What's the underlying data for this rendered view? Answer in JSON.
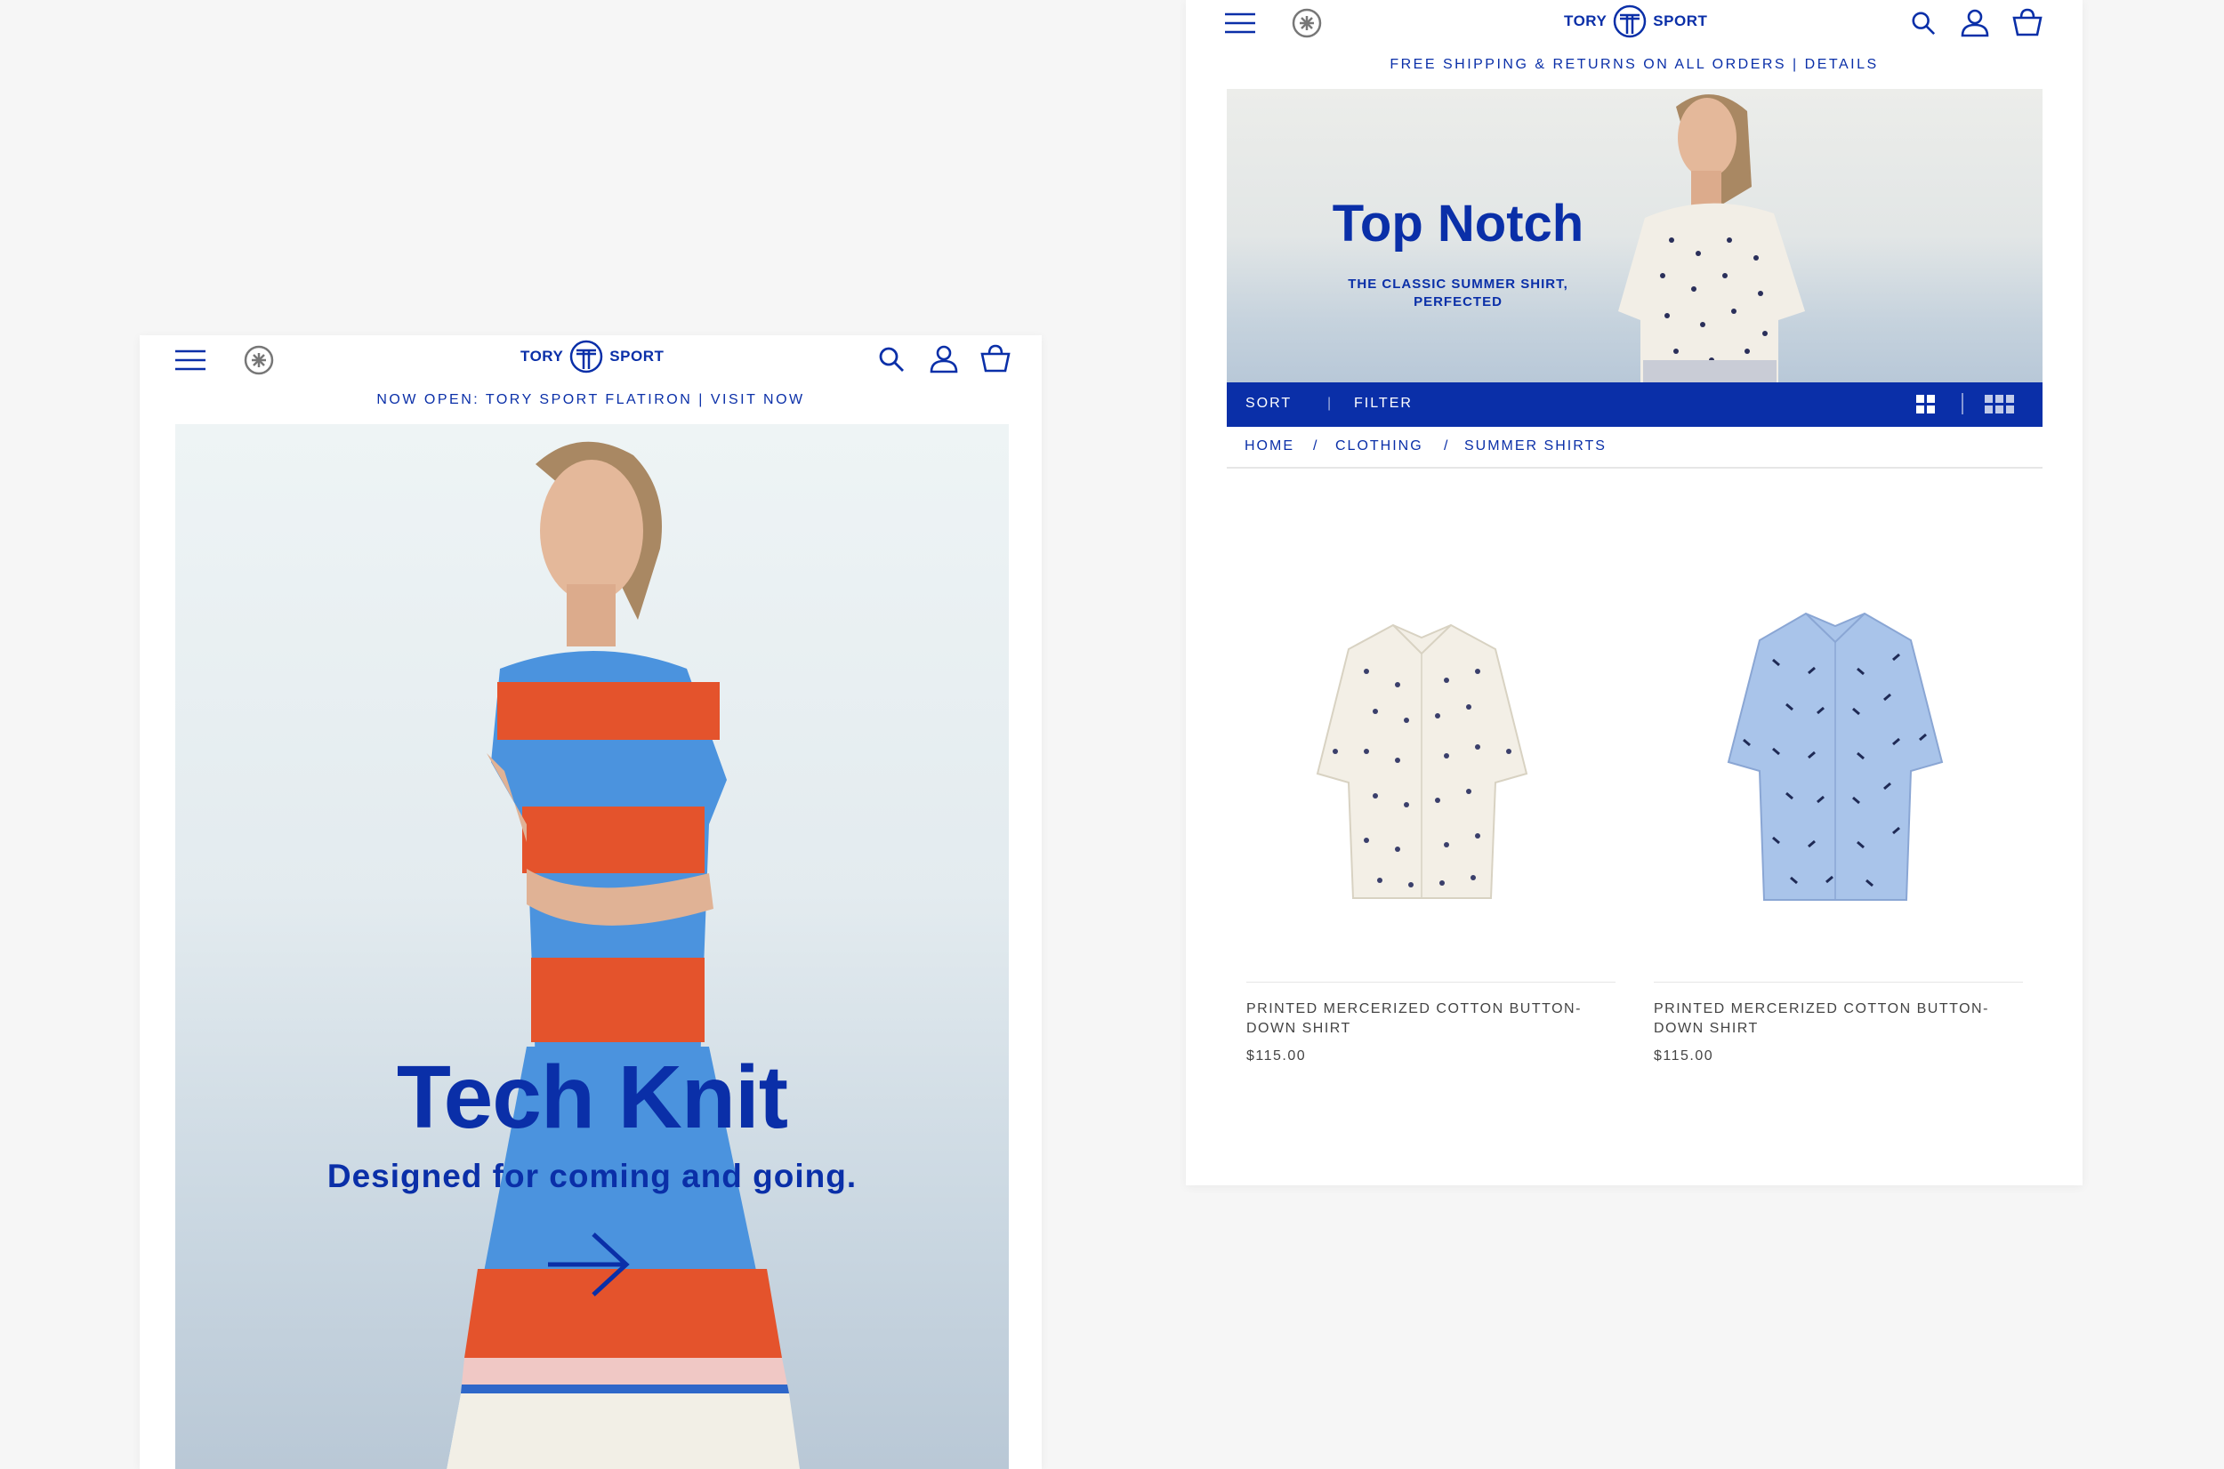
{
  "left_screen": {
    "logo": {
      "left": "TORY",
      "right": "SPORT"
    },
    "promo": "NOW OPEN: TORY SPORT FLATIRON | VISIT NOW",
    "hero": {
      "title": "Tech Knit",
      "subtitle": "Designed for coming and going."
    },
    "icons": [
      "menu-icon",
      "tory-medallion-icon",
      "search-icon",
      "account-icon",
      "shopping-bag-icon",
      "arrow-right-icon"
    ]
  },
  "right_screen": {
    "logo": {
      "left": "TORY",
      "right": "SPORT"
    },
    "promo": "FREE SHIPPING & RETURNS ON ALL ORDERS | DETAILS",
    "hero": {
      "title": "Top Notch",
      "subtitle": "THE CLASSIC SUMMER SHIRT, PERFECTED"
    },
    "toolbar": {
      "sort": "SORT",
      "separator": "|",
      "filter": "FILTER"
    },
    "breadcrumb": [
      "HOME",
      "/",
      "CLOTHING",
      "/",
      "SUMMER SHIRTS"
    ],
    "products": [
      {
        "name": "PRINTED MERCERIZED COTTON BUTTON-DOWN SHIRT",
        "price": "$115.00",
        "color": "#f3efe6"
      },
      {
        "name": "PRINTED MERCERIZED COTTON BUTTON-DOWN SHIRT",
        "price": "$115.00",
        "color": "#a9c4ea"
      }
    ]
  },
  "colors": {
    "brand": "#0a2fa8",
    "background": "#f6f6f6"
  }
}
